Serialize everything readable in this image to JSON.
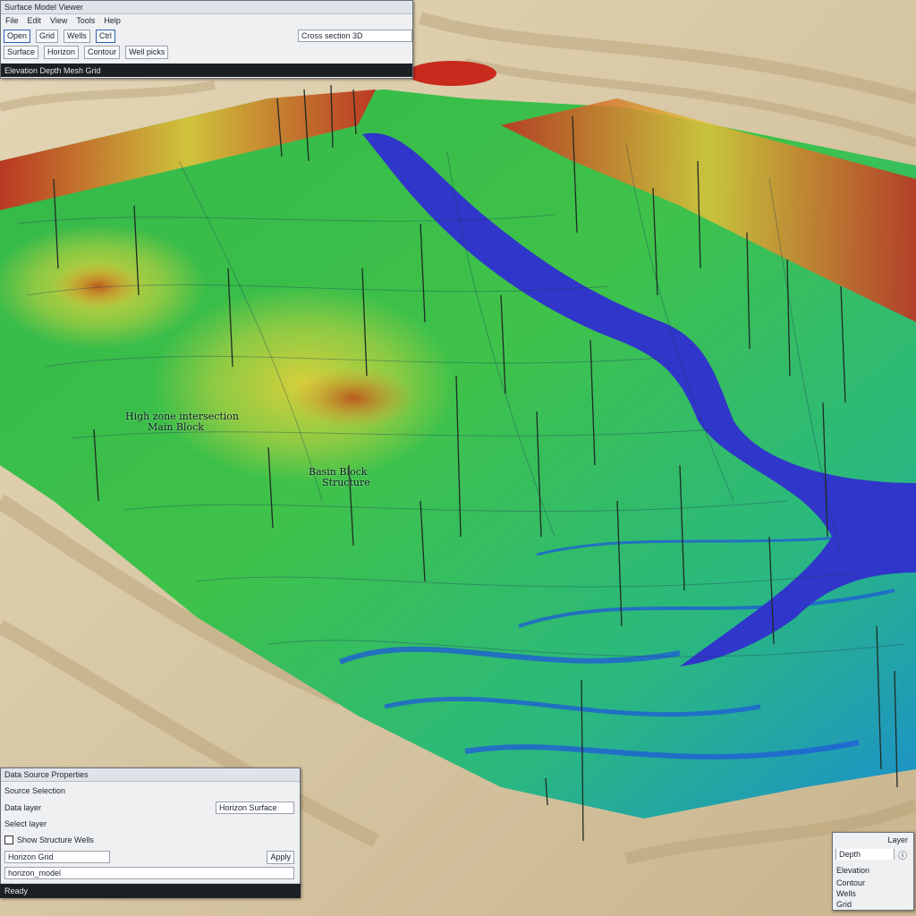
{
  "colors": {
    "sand": "#d9c9a6",
    "basin_green": "#3cbf4a",
    "basin_yellow": "#d6cf3a",
    "ridge_red": "#c92a1e",
    "river_blue": "#2f36c9",
    "panel_bg": "#eef0f2",
    "accent_blue": "#2c5fb5"
  },
  "top_window": {
    "title": "Surface Model Viewer",
    "menu": [
      "File",
      "Edit",
      "View",
      "Tools",
      "Help"
    ],
    "toolbar_buttons": [
      "Open",
      "Grid",
      "Wells",
      "Ctrl"
    ],
    "toolbar_field": "Cross section 3D",
    "row2": [
      "Surface",
      "Horizon",
      "Contour",
      "Well picks"
    ],
    "status": "Elevation Depth Mesh Grid"
  },
  "bottom_panel": {
    "title": "Data Source Properties",
    "header": "Source Selection",
    "field_label": "Data layer",
    "field_value": "Horizon Surface",
    "list_item": "Select layer",
    "check_label": "Show Structure Wells",
    "combo_value": "Horizon Grid",
    "combo_button": "Apply",
    "path_value": "horizon_model",
    "footer": "Ready"
  },
  "mini_panel": {
    "title": "Layer",
    "line1": "Depth",
    "line2": "Elevation",
    "line3": "Contour",
    "line4": "Wells",
    "line5": "Grid"
  },
  "annotations": [
    {
      "text": "High zone intersection",
      "sub": "Main Block"
    },
    {
      "text": "Basin Block",
      "sub": "Structure"
    }
  ]
}
